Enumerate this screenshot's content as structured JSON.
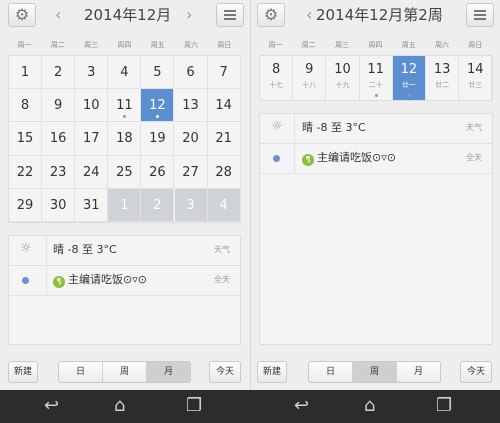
{
  "left": {
    "title": "2014年12月",
    "weekdays": [
      "周一",
      "周二",
      "周三",
      "周四",
      "周五",
      "周六",
      "周日"
    ],
    "days": [
      [
        "1",
        "2",
        "3",
        "4",
        "5",
        "6",
        "7"
      ],
      [
        "8",
        "9",
        "10",
        "11",
        "12",
        "13",
        "14"
      ],
      [
        "15",
        "16",
        "17",
        "18",
        "19",
        "20",
        "21"
      ],
      [
        "22",
        "23",
        "24",
        "25",
        "26",
        "27",
        "28"
      ],
      [
        "29",
        "30",
        "31",
        "1",
        "2",
        "3",
        "4"
      ]
    ],
    "selected_day": "12",
    "events": {
      "weather_text": "晴 -8 至 3°C",
      "weather_tag": "天气",
      "event_text": "主编请吃饭⊙▿⊙",
      "event_tag": "全天"
    },
    "buttons": {
      "new": "新建",
      "day": "日",
      "week": "周",
      "month": "月",
      "today": "今天"
    },
    "active_view": "月"
  },
  "right": {
    "title": "2014年12月第2周",
    "weekdays": [
      "周一",
      "周二",
      "周三",
      "周四",
      "周五",
      "周六",
      "周日"
    ],
    "days": [
      {
        "num": "8",
        "lunar": "十七"
      },
      {
        "num": "9",
        "lunar": "十八"
      },
      {
        "num": "10",
        "lunar": "十九"
      },
      {
        "num": "11",
        "lunar": "二十"
      },
      {
        "num": "12",
        "lunar": "廿一"
      },
      {
        "num": "13",
        "lunar": "廿二"
      },
      {
        "num": "14",
        "lunar": "廿三"
      }
    ],
    "selected_day": "12",
    "events": {
      "weather_text": "晴 -8 至 3°C",
      "weather_tag": "天气",
      "event_text": "主编请吃饭⊙▿⊙",
      "event_tag": "全天"
    },
    "buttons": {
      "new": "新建",
      "day": "日",
      "week": "周",
      "month": "月",
      "today": "今天"
    },
    "active_view": "周"
  },
  "icons": {
    "settings": "gear-icon",
    "menu": "menu-icon",
    "prev": "chevron-left-icon",
    "next": "chevron-right-icon",
    "weather": "sun-icon",
    "food": "food-icon",
    "back": "back-icon",
    "home": "home-icon",
    "recents": "recents-icon"
  },
  "colors": {
    "selected": "#5b8fd2",
    "event_dot": "#6b8fd0",
    "food_badge": "#8bbf3c",
    "nav_bar": "#2c2c2c"
  }
}
